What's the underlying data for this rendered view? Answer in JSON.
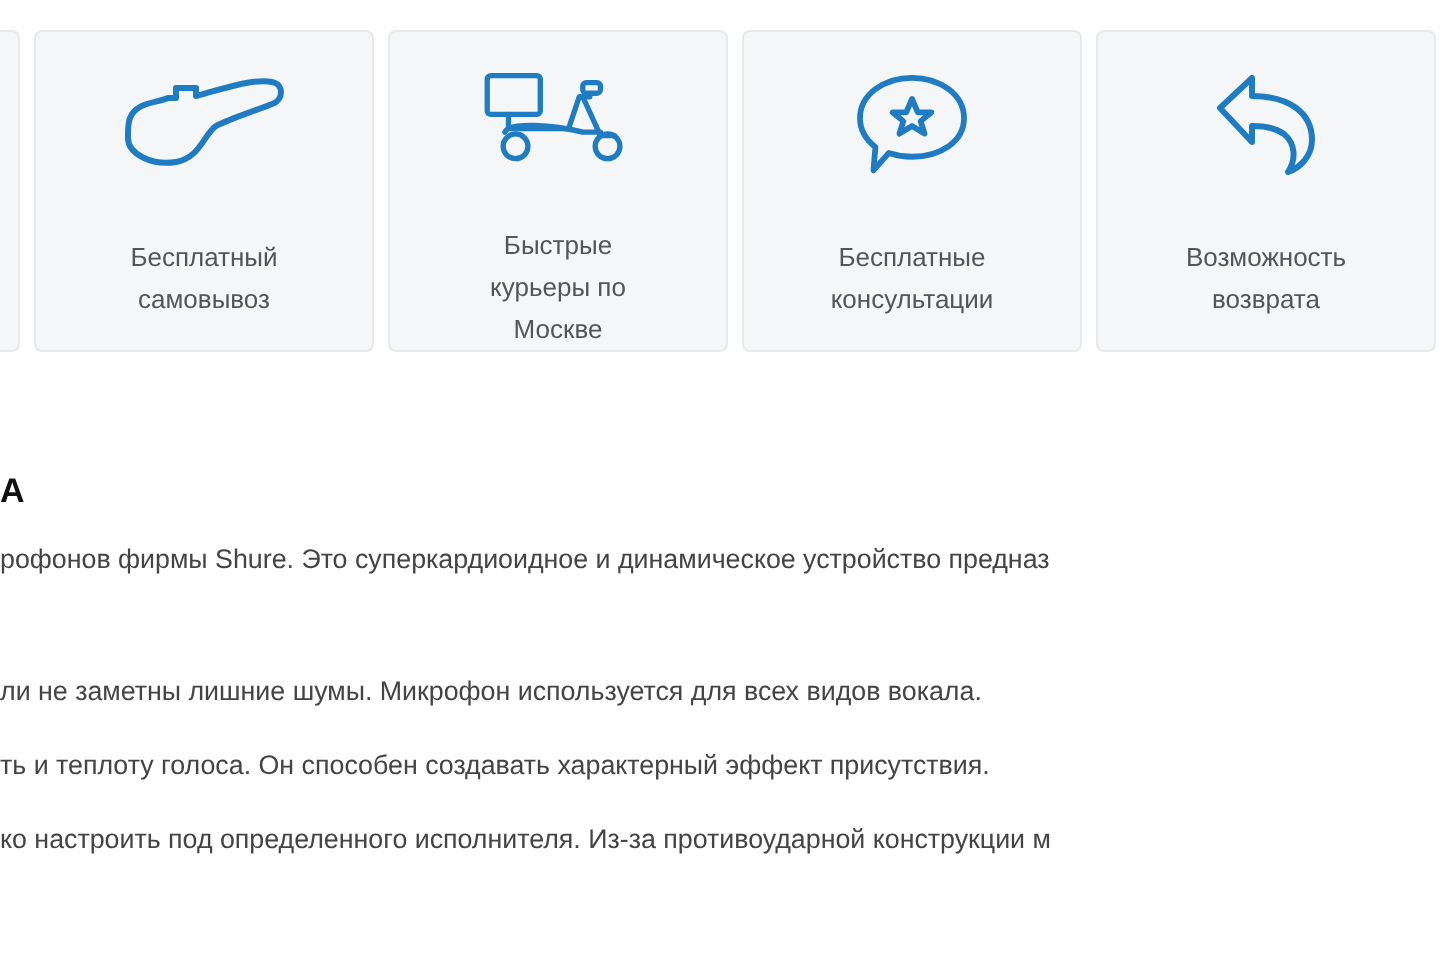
{
  "features": [
    {
      "label_lines": [
        "Бесплатный",
        "самовывоз"
      ]
    },
    {
      "label_lines": [
        "Быстрые",
        "курьеры по",
        "Москве"
      ]
    },
    {
      "label_lines": [
        "Бесплатные",
        "консультации"
      ]
    },
    {
      "label_lines": [
        "Возможность",
        "возврата"
      ]
    }
  ],
  "heading": "А",
  "paragraphs": [
    "рофонов фирмы Shure. Это суперкардиоидное и динамическое устройство предназ",
    "ли не заметны лишние шумы. Микрофон используется для всех видов вокала.",
    "ть и теплоту голоса. Он способен создавать характерный эффект присутствия.",
    "ко настроить под определенного исполнителя. Из-за противоударной конструкции м"
  ]
}
